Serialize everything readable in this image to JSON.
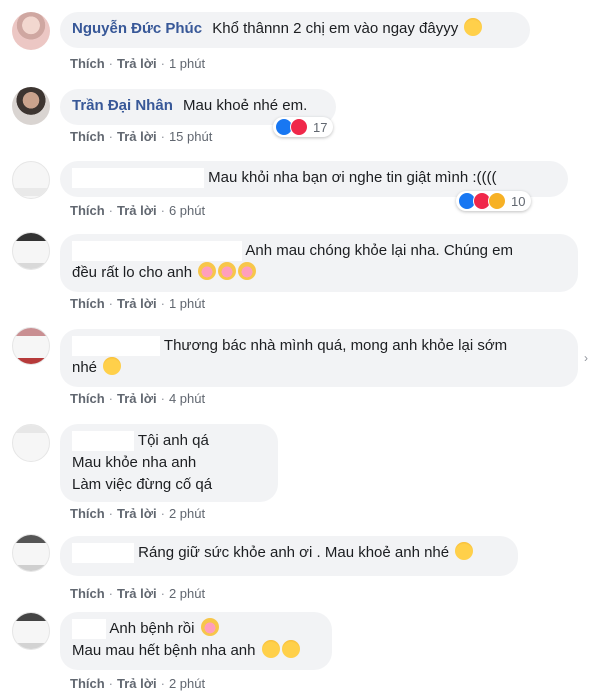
{
  "actions": {
    "like": "Thích",
    "reply": "Trả lời"
  },
  "comments": [
    {
      "name": "Nguyễn Đức Phúc",
      "text": "Khổ thânnn 2 chị em vào ngay đâyyy",
      "time": "1 phút"
    },
    {
      "name": "Trần Đại Nhân",
      "text": "Mau khoẻ nhé em.",
      "time": "15 phút",
      "reaction_count": "17",
      "reaction_icons": [
        "like-icon",
        "love-icon"
      ]
    },
    {
      "text": "Mau khỏi nha bạn ơi nghe tin giật mình :((((",
      "time": "6 phút",
      "reaction_count": "10",
      "reaction_icons": [
        "like-icon",
        "love-icon",
        "sad-icon"
      ]
    },
    {
      "line1": "Anh mau chóng khỏe lại nha. Chúng em",
      "line2": "đều rất lo cho anh",
      "time": "1 phút"
    },
    {
      "line1": "Thương bác nhà mình quá, mong anh khỏe lại sớm",
      "line2": "nhé",
      "time": "4 phút"
    },
    {
      "line1": "Tội anh qá",
      "line2": "Mau khỏe nha anh",
      "line3": "Làm việc đừng cố qá",
      "time": "2 phút"
    },
    {
      "text": "Ráng giữ sức khỏe anh ơi . Mau khoẻ anh nhé",
      "time": "2 phút"
    },
    {
      "line1": "Anh bệnh rồi",
      "line2": "Mau mau hết bệnh nha anh",
      "time": "2 phút"
    }
  ]
}
